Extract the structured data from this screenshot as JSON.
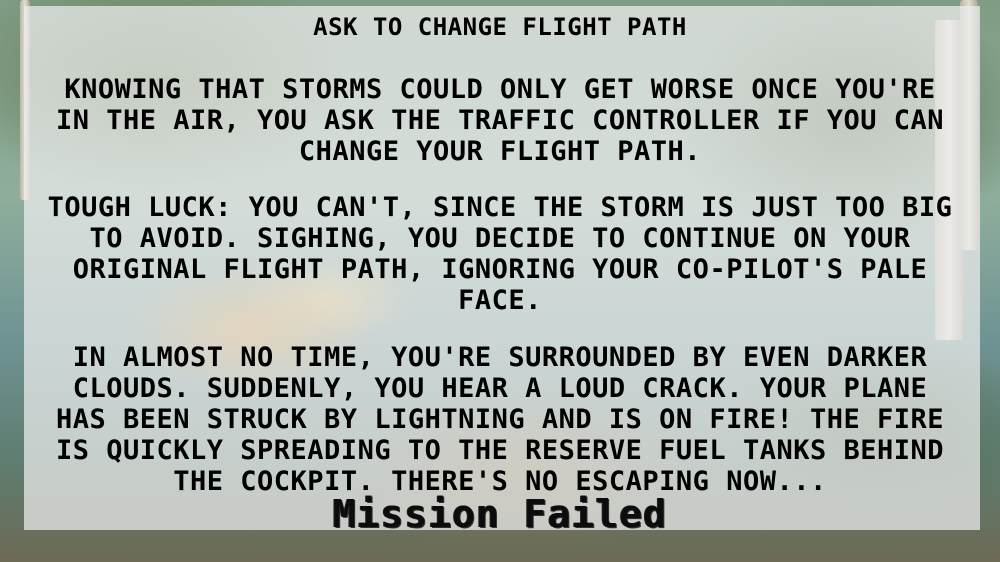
{
  "screen": {
    "title": "Ask to change flight path",
    "paragraphs": [
      "Knowing that storms could only get worse once you're in the air, you ask the traffic controller if you can change your flight path.",
      "Tough luck: you can't, since the storm is just too big to avoid. Sighing, you decide to continue on your original flight path, ignoring your co-pilot's pale face.",
      "In almost no time, you're surrounded by even darker clouds. Suddenly, you hear a loud crack. Your plane has been struck by lightning and is on fire! The fire is quickly spreading to the reserve fuel tanks behind the cockpit. There's no escaping now..."
    ],
    "result": "Mission Failed"
  },
  "colors": {
    "panel": "#eeeeee",
    "text": "#000000"
  }
}
